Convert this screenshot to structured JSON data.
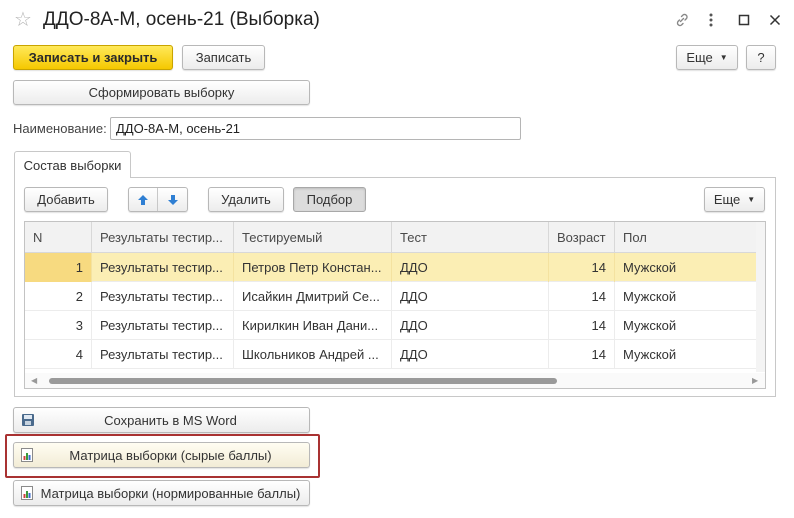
{
  "window": {
    "title": "ДДО-8А-М, осень-21 (Выборка)"
  },
  "toolbar": {
    "save_close_label": "Записать и закрыть",
    "save_label": "Записать",
    "more_label": "Еще",
    "help_label": "?"
  },
  "form": {
    "generate_label": "Сформировать выборку",
    "name_label": "Наименование:",
    "name_value": "ДДО-8А-М, осень-21"
  },
  "tab": {
    "label": "Состав выборки"
  },
  "table_toolbar": {
    "add_label": "Добавить",
    "delete_label": "Удалить",
    "pick_label": "Подбор",
    "more_label": "Еще"
  },
  "table": {
    "columns": [
      "N",
      "Результаты тестир...",
      "Тестируемый",
      "Тест",
      "Возраст",
      "Пол"
    ],
    "rows": [
      {
        "n": "1",
        "result": "Результаты тестир...",
        "person": "Петров Петр Констан...",
        "test": "ДДО",
        "age": "14",
        "sex": "Мужской"
      },
      {
        "n": "2",
        "result": "Результаты тестир...",
        "person": "Исайкин Дмитрий Се...",
        "test": "ДДО",
        "age": "14",
        "sex": "Мужской"
      },
      {
        "n": "3",
        "result": "Результаты тестир...",
        "person": "Кирилкин Иван Дани...",
        "test": "ДДО",
        "age": "14",
        "sex": "Мужской"
      },
      {
        "n": "4",
        "result": "Результаты тестир...",
        "person": "Школьников Андрей ...",
        "test": "ДДО",
        "age": "14",
        "sex": "Мужской"
      }
    ],
    "selected_row": 1
  },
  "actions": {
    "save_word_label": "Сохранить в MS Word",
    "matrix_raw_label": "Матрица выборки (сырые баллы)",
    "matrix_norm_label": "Матрица выборки (нормированные баллы)"
  },
  "colors": {
    "primary_button": "#f5c800",
    "selected_row": "#fbeeb4",
    "highlight_border": "#a93232",
    "arrow_blue": "#2f7fd3"
  },
  "icons": {
    "favorite": "star-icon",
    "link": "link-icon",
    "more": "more-icon",
    "maximize": "maximize-icon",
    "close": "close-icon",
    "move_up": "arrow-up-icon",
    "move_down": "arrow-down-icon",
    "save": "floppy-disk-icon",
    "report": "report-icon"
  }
}
